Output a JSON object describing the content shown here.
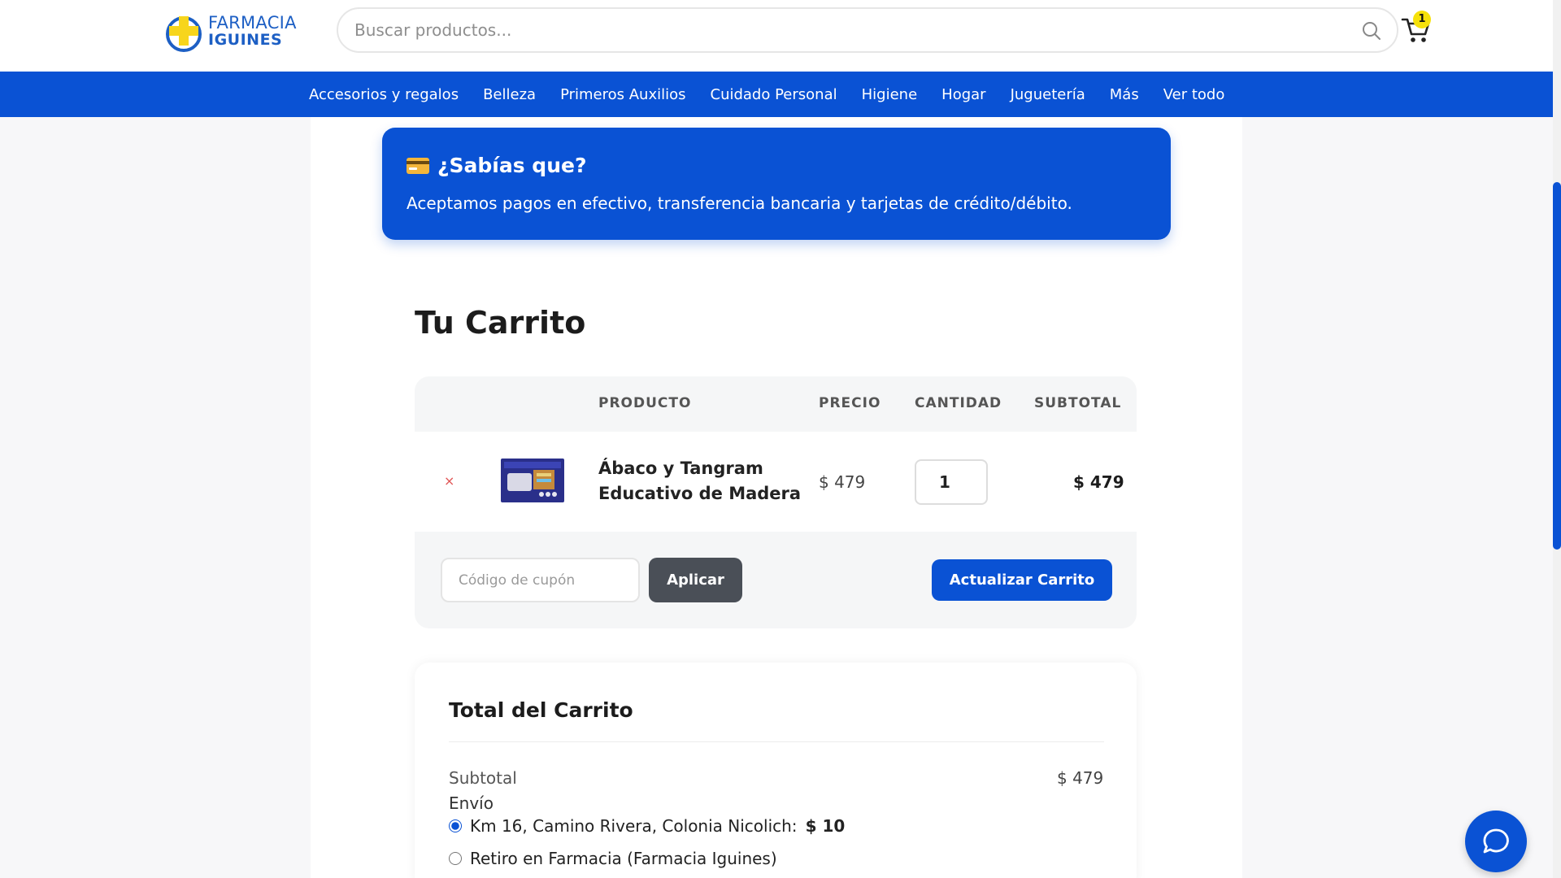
{
  "header": {
    "logo_line1": "FARMACIA",
    "logo_line2": "IGUINES",
    "search_placeholder": "Buscar productos...",
    "cart_count": "1"
  },
  "nav": {
    "items": [
      "Accesorios y regalos",
      "Belleza",
      "Primeros Auxilios",
      "Cuidado Personal",
      "Higiene",
      "Hogar",
      "Juguetería",
      "Más",
      "Ver todo"
    ]
  },
  "info": {
    "title": "¿Sabías que?",
    "text": "Aceptamos pagos en efectivo, transferencia bancaria y tarjetas de crédito/débito."
  },
  "cart": {
    "title": "Tu Carrito",
    "columns": {
      "product": "PRODUCTO",
      "price": "PRECIO",
      "quantity": "CANTIDAD",
      "subtotal": "SUBTOTAL"
    },
    "items": [
      {
        "remove": "×",
        "name": "Ábaco y Tangram Educativo de Madera",
        "price": "$ 479",
        "quantity": "1",
        "subtotal": "$ 479"
      }
    ],
    "coupon_placeholder": "Código de cupón",
    "apply_label": "Aplicar",
    "update_label": "Actualizar Carrito"
  },
  "totals": {
    "title": "Total del Carrito",
    "subtotal_label": "Subtotal",
    "subtotal_value": "$ 479",
    "shipping_label": "Envío",
    "shipping_options": [
      {
        "label": "Km 16, Camino Rivera, Colonia Nicolich:",
        "price": "$ 10",
        "selected": true
      },
      {
        "label": "Retiro en Farmacia (Farmacia Iguines)",
        "price": "",
        "selected": false
      }
    ]
  },
  "colors": {
    "brand_blue": "#0a52d4",
    "badge_yellow": "#f6e10a",
    "remove_red": "#e05555"
  },
  "icons": {
    "search": "search-icon",
    "cart": "cart-icon",
    "credit_card": "credit-card-icon",
    "chat": "chat-icon"
  }
}
